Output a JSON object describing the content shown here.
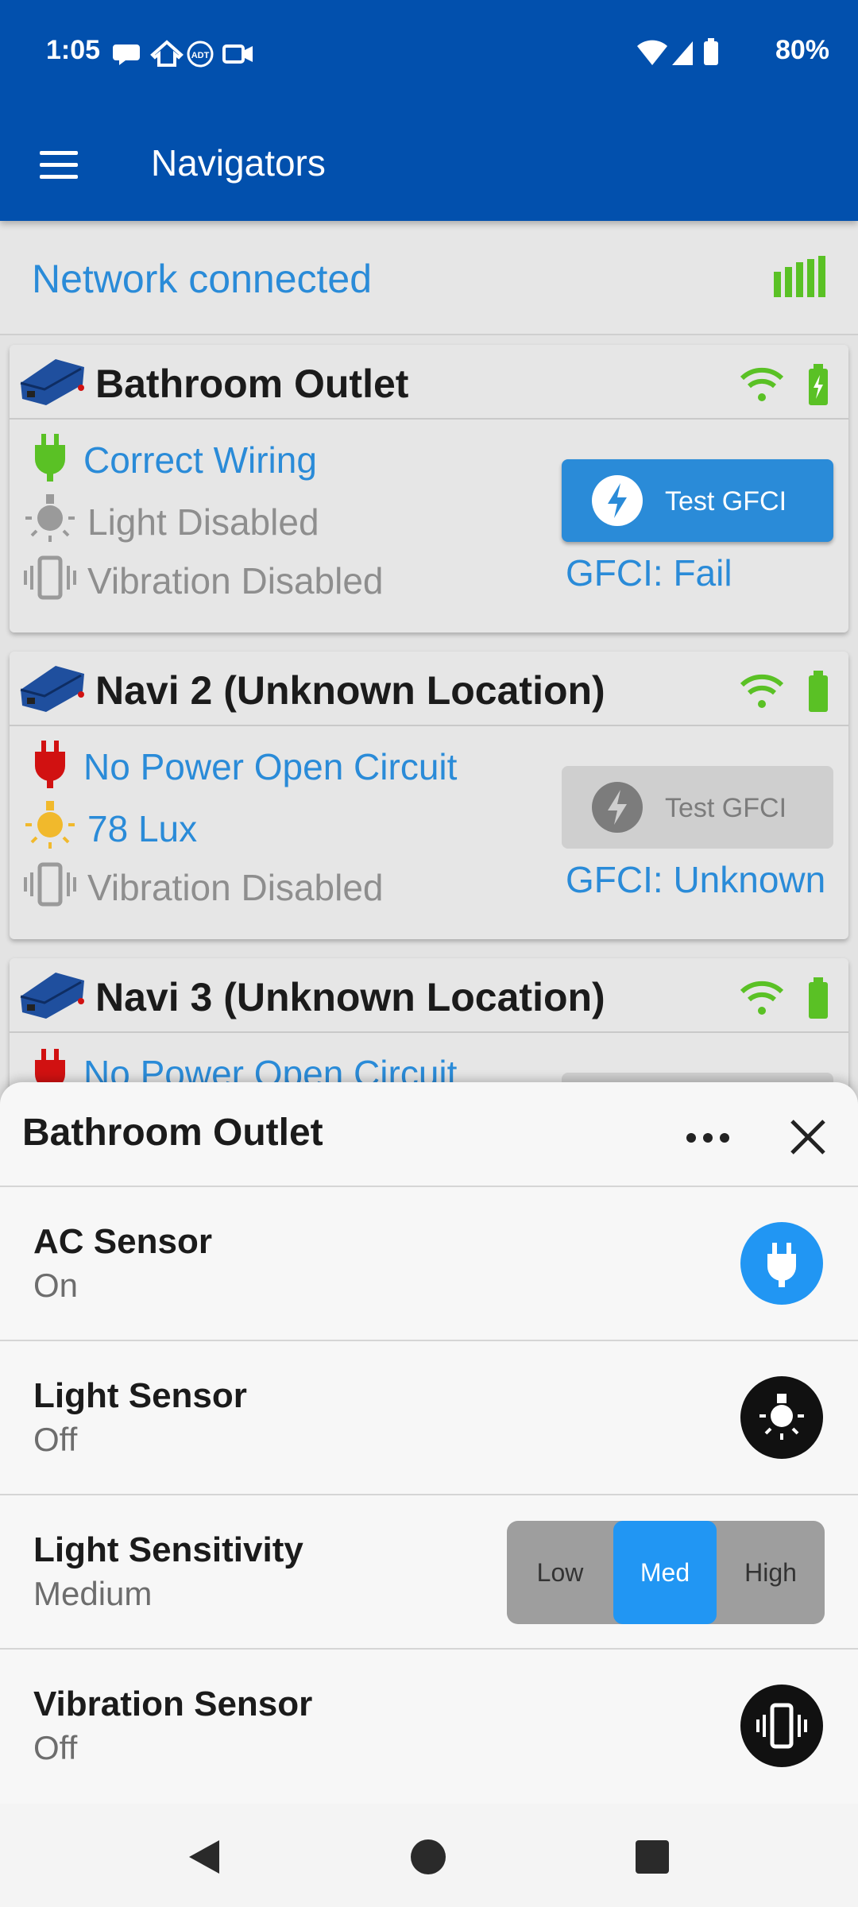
{
  "status_bar": {
    "time": "1:05",
    "battery": "80%"
  },
  "app_bar": {
    "title": "Navigators"
  },
  "network": {
    "status": "Network connected"
  },
  "cards": [
    {
      "title": "Bathroom Outlet",
      "wiring": "Correct Wiring",
      "light": "Light Disabled",
      "vibration": "Vibration Disabled",
      "gfci_button": "Test GFCI",
      "gfci_status": "GFCI: Fail"
    },
    {
      "title": "Navi 2 (Unknown Location)",
      "wiring": "No Power Open Circuit",
      "light": "78 Lux",
      "vibration": "Vibration Disabled",
      "gfci_button": "Test GFCI",
      "gfci_status": "GFCI: Unknown"
    },
    {
      "title": "Navi 3 (Unknown Location)",
      "wiring": "No Power Open Circuit"
    }
  ],
  "sheet": {
    "title": "Bathroom Outlet",
    "rows": [
      {
        "label": "AC Sensor",
        "value": "On"
      },
      {
        "label": "Light Sensor",
        "value": "Off"
      },
      {
        "label": "Light Sensitivity",
        "value": "Medium"
      },
      {
        "label": "Vibration Sensor",
        "value": "Off"
      }
    ],
    "sensitivity_options": [
      "Low",
      "Med",
      "High"
    ]
  },
  "colors": {
    "primary": "#0250ad",
    "accent_blue": "#2a8bd8",
    "active_blue": "#2196f3",
    "ok_green": "#5ac125",
    "fault_red": "#d11111",
    "light_yellow": "#f1b92c"
  }
}
